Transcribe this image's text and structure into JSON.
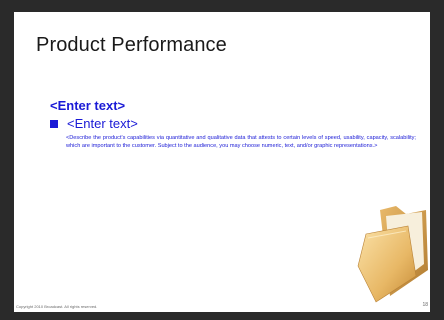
{
  "slide": {
    "title": "Product Performance",
    "subheading": "<Enter text>",
    "bullet_text": "<Enter text>",
    "description": "<Describe the product's capabilities via quantitative and qualitative data that attests to certain levels of speed, usability, capacity, scalability; which are important to the customer.  Subject to the audience, you may choose numeric, text, and/or graphic representations.>",
    "copyright": "Copyright 2010 Broadcast. All rights reserved.",
    "page_number": "18"
  },
  "colors": {
    "accent": "#1a1ad6",
    "title": "#1a1a1a",
    "background_frame": "#2a2a2a",
    "slide_bg": "#ffffff"
  },
  "icons": {
    "folder": "folder-icon",
    "bullet": "square-bullet-icon"
  }
}
